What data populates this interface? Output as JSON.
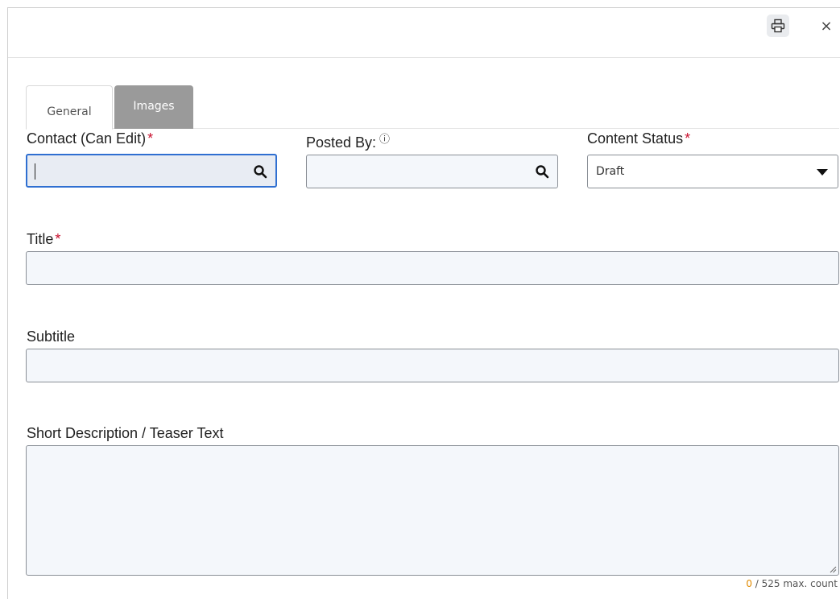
{
  "toolbar": {
    "print_icon": "printer-icon",
    "close_label": "×"
  },
  "tabs": [
    {
      "label": "General",
      "active": true
    },
    {
      "label": "Images",
      "active": false
    }
  ],
  "form": {
    "contact": {
      "label": "Contact (Can Edit)",
      "required_mark": "*",
      "value": ""
    },
    "posted_by": {
      "label": "Posted By:",
      "info_icon": "ⓘ",
      "value": ""
    },
    "content_status": {
      "label": "Content Status",
      "required_mark": "*",
      "selected": "Draft"
    },
    "title": {
      "label": "Title",
      "required_mark": "*",
      "value": ""
    },
    "subtitle": {
      "label": "Subtitle",
      "value": ""
    },
    "short_description": {
      "label": "Short Description / Teaser Text",
      "value": "",
      "count": "0",
      "counter_suffix": " / 525 max. count"
    }
  },
  "colors": {
    "required": "#c8102e",
    "focus": "#2f6fd1",
    "counter_zero": "#e08a00",
    "inactive_tab": "#9a9a9a"
  }
}
